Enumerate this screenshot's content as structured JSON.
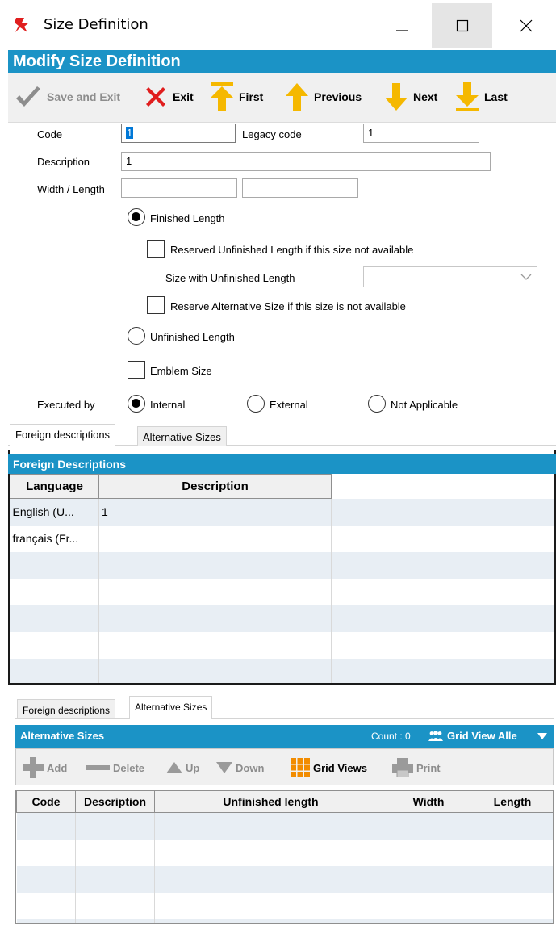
{
  "window": {
    "title": "Size Definition"
  },
  "header": {
    "title": "Modify Size Definition"
  },
  "toolbar": {
    "save_exit": "Save and Exit",
    "exit": "Exit",
    "first": "First",
    "previous": "Previous",
    "next": "Next",
    "last": "Last"
  },
  "form": {
    "code_label": "Code",
    "code_value": "1",
    "legacy_label": "Legacy code",
    "legacy_value": "1",
    "description_label": "Description",
    "description_value": "1",
    "width_length_label": "Width / Length",
    "width_value": "",
    "length_value": "",
    "finished_length": "Finished Length",
    "reserved_unfinished": "Reserved Unfinished Length if this size not available",
    "size_with_unfinished": "Size with Unfinished Length",
    "reserve_alternative": "Reserve Alternative Size if this size is not available",
    "unfinished_length": "Unfinished Length",
    "emblem_size": "Emblem Size",
    "executed_by_label": "Executed by",
    "exec_internal": "Internal",
    "exec_external": "External",
    "exec_not_applicable": "Not Applicable"
  },
  "tabs_top": {
    "foreign": "Foreign descriptions",
    "alternative": "Alternative Sizes"
  },
  "foreign_panel": {
    "title": "Foreign Descriptions",
    "columns": [
      "Language",
      "Description"
    ],
    "rows": [
      [
        "English (U...",
        "1"
      ],
      [
        "français (Fr...",
        ""
      ]
    ]
  },
  "tabs_bottom": {
    "foreign": "Foreign descriptions",
    "alternative": "Alternative Sizes"
  },
  "alt_panel": {
    "title": "Alternative Sizes",
    "count": "Count : 0",
    "grid_view": "Grid View Alle",
    "toolbar": {
      "add": "Add",
      "delete": "Delete",
      "up": "Up",
      "down": "Down",
      "grid_views": "Grid Views",
      "print": "Print"
    },
    "columns": [
      "Code",
      "Description",
      "Unfinished length",
      "Width",
      "Length"
    ]
  },
  "colors": {
    "accent": "#1b93c6",
    "alt_row": "#e8eef4",
    "arrow": "#f5b800",
    "exit_red": "#e01e1e"
  }
}
